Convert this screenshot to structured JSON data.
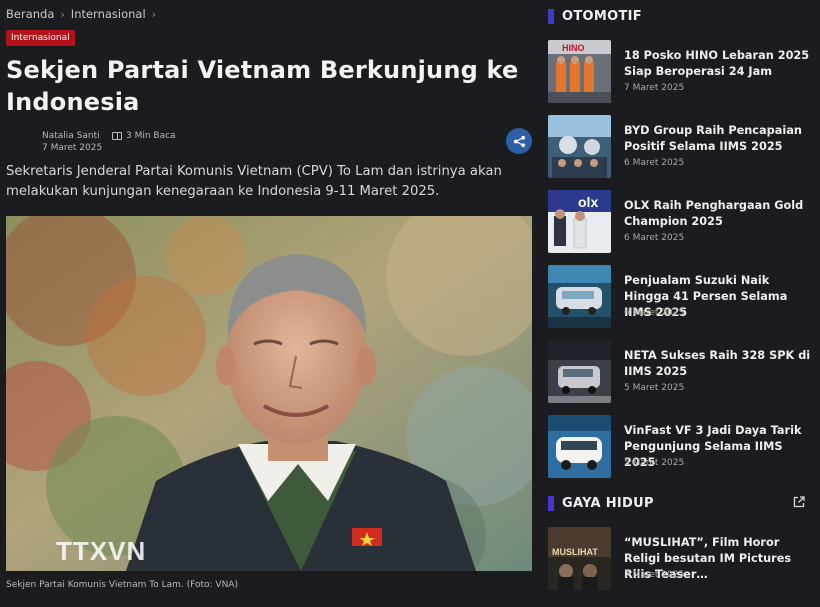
{
  "breadcrumb": {
    "home": "Beranda",
    "category": "Internasional"
  },
  "article": {
    "badge": "Internasional",
    "title": "Sekjen Partai Vietnam Berkunjung ke Indonesia",
    "author": "Natalia Santi",
    "date": "7 Maret 2025",
    "read_time": "3 Min Baca",
    "lead": "Sekretaris Jenderal Partai Komunis Vietnam (CPV) To Lam dan istrinya akan melakukan kunjungan kenegaraan ke Indonesia 9-11 Maret 2025.",
    "photo_watermark": "TTXVN",
    "caption": "Sekjen Partai Komunis Vietnam To Lam. (Foto: VNA)"
  },
  "sidebar": {
    "otomotif": {
      "heading": "OTOMOTIF",
      "items": [
        {
          "title": "18 Posko HINO Lebaran 2025 Siap Beroperasi 24 Jam",
          "date": "7 Maret 2025",
          "thumb_label": "HINO"
        },
        {
          "title": "BYD Group Raih Pencapaian Positif Selama IIMS 2025",
          "date": "6 Maret 2025"
        },
        {
          "title": "OLX Raih Penghargaan Gold Champion 2025",
          "date": "6 Maret 2025",
          "thumb_label": "olx"
        },
        {
          "title": "Penjualam Suzuki Naik Hingga 41 Persen Selama IIMS 2025",
          "date": "6 Maret 2025"
        },
        {
          "title": "NETA Sukses Raih 328 SPK di IIMS 2025",
          "date": "5 Maret 2025"
        },
        {
          "title": "VinFast VF 3 Jadi Daya Tarik Pengunjung Selama IIMS 2025",
          "date": "5 Maret 2025"
        }
      ]
    },
    "gaya_hidup": {
      "heading": "GAYA HIDUP",
      "items": [
        {
          "title": "“MUSLIHAT”, Film Horor Religi besutan IM Pictures Rilis Teaser…",
          "date": "7 Maret 2025",
          "thumb_label": "MUSLIHAT"
        }
      ]
    }
  },
  "colors": {
    "background": "#1b1c1f",
    "badge": "#b3121b",
    "accent": "#4338ca",
    "share": "#2d5fa8"
  }
}
